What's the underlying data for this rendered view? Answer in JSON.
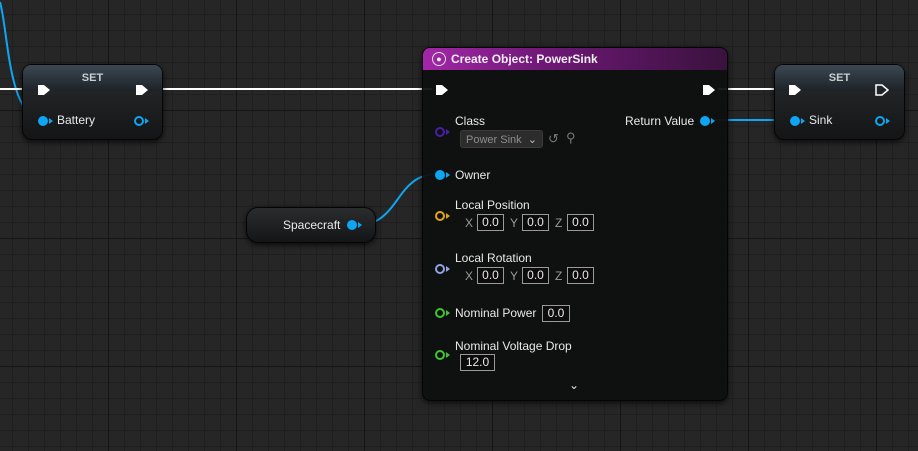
{
  "nodes": {
    "set_battery": {
      "header": "SET",
      "var_label": "Battery"
    },
    "set_sink": {
      "header": "SET",
      "var_label": "Sink"
    },
    "spacecraft": {
      "label": "Spacecraft"
    },
    "create_object": {
      "title": "Create Object: PowerSink",
      "class_label": "Class",
      "class_value": "Power Sink",
      "return_label": "Return Value",
      "owner_label": "Owner",
      "local_position": {
        "label": "Local Position",
        "x": "0.0",
        "y": "0.0",
        "z": "0.0"
      },
      "local_rotation": {
        "label": "Local Rotation",
        "x": "0.0",
        "y": "0.0",
        "z": "0.0"
      },
      "nominal_power": {
        "label": "Nominal Power",
        "value": "0.0"
      },
      "nominal_voltage_drop": {
        "label": "Nominal Voltage Drop",
        "value": "12.0"
      }
    }
  },
  "axis_labels": {
    "x": "X",
    "y": "Y",
    "z": "Z"
  },
  "icons": {
    "exec": "exec-pin-icon",
    "object": "object-pin-icon",
    "globe": "globe-icon",
    "browse": "browse-icon",
    "search": "search-icon",
    "expand": "chevron-down-icon"
  },
  "colors": {
    "object_pin": "#0ea5f2",
    "class_pin": "#4a1fa8",
    "vector_pin": "#e0a51a",
    "rotator_pin": "#8fa2e6",
    "float_pin": "#3fc52f",
    "exec_wire": "#ffffff",
    "header_purple": "#a327a8"
  }
}
